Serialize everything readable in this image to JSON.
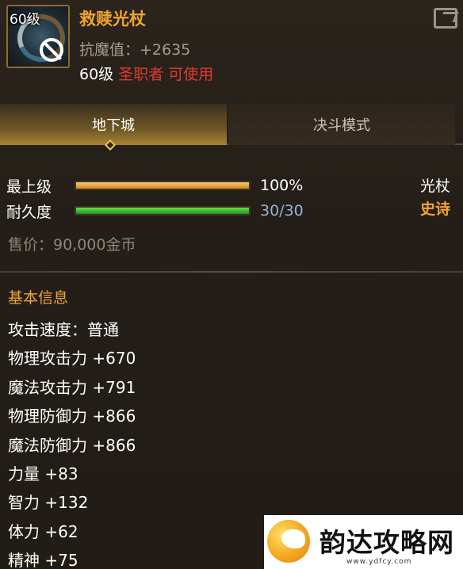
{
  "item": {
    "level_tag": "60级",
    "name": "救赎光杖",
    "resist_magic": "抗魔值：+2635",
    "req_level": "60级",
    "req_class": "圣职者 可使用",
    "type": "光杖",
    "rarity": "史诗"
  },
  "tabs": [
    {
      "label": "地下城",
      "active": true
    },
    {
      "label": "决斗模式",
      "active": false
    }
  ],
  "stats": {
    "quality_label": "最上级",
    "quality_percent": 100,
    "quality_value": "100%",
    "durability_label": "耐久度",
    "durability_current": 30,
    "durability_max": 30,
    "durability_value": "30/30"
  },
  "price": "售价：90,000金币",
  "basic_info": {
    "title": "基本信息",
    "attributes": [
      "攻击速度：普通",
      "物理攻击力 +670",
      "魔法攻击力 +791",
      "物理防御力 +866",
      "魔法防御力 +866",
      "力量 +83",
      "智力 +132",
      "体力 +62",
      "精神 +75"
    ]
  },
  "watermark": {
    "text": "韵达攻略网",
    "url": "www.ydfcy.com"
  },
  "colors": {
    "item_name": "#f0a431",
    "class_req": "#e23a2e",
    "durability_text": "#9ab1d6",
    "quality_bar": "#d7891f",
    "durability_bar": "#20901a"
  },
  "icons": [
    "item-weapon-icon",
    "unusable-icon",
    "share-icon",
    "tab-diamond-icon",
    "site-logo-icon"
  ]
}
